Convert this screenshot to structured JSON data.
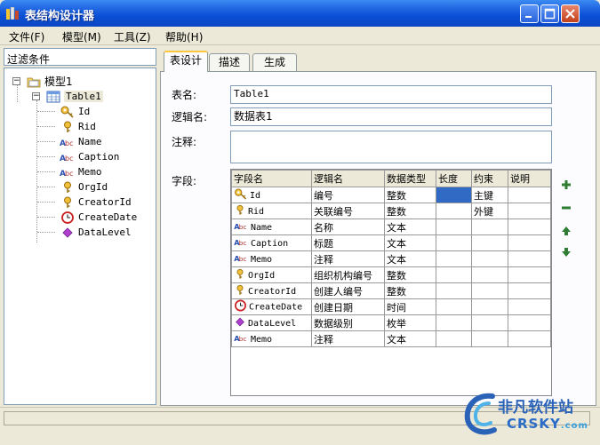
{
  "window": {
    "title": "表结构设计器"
  },
  "menu": [
    {
      "label": "文件(F)"
    },
    {
      "label": "模型(M)"
    },
    {
      "label": "工具(Z)"
    },
    {
      "label": "帮助(H)"
    }
  ],
  "filter": {
    "label": "过滤条件"
  },
  "tree": {
    "model": "模型1",
    "table": "Table1",
    "fields": [
      {
        "name": "Id",
        "icon": "key-icon"
      },
      {
        "name": "Rid",
        "icon": "foreign-key-icon"
      },
      {
        "name": "Name",
        "icon": "text-type-icon"
      },
      {
        "name": "Caption",
        "icon": "text-type-icon"
      },
      {
        "name": "Memo",
        "icon": "text-type-icon"
      },
      {
        "name": "OrgId",
        "icon": "foreign-key-icon"
      },
      {
        "name": "CreatorId",
        "icon": "foreign-key-icon"
      },
      {
        "name": "CreateDate",
        "icon": "clock-icon"
      },
      {
        "name": "DataLevel",
        "icon": "enum-diamond-icon"
      }
    ]
  },
  "tabs": [
    {
      "label": "表设计",
      "active": true
    },
    {
      "label": "描述",
      "active": false
    },
    {
      "label": "生成",
      "active": false
    }
  ],
  "form": {
    "table_name_label": "表名:",
    "table_name_value": "Table1",
    "logical_name_label": "逻辑名:",
    "logical_name_value": "数据表1",
    "comment_label": "注释:",
    "comment_value": "",
    "fields_label": "字段:"
  },
  "grid": {
    "headers": [
      "字段名",
      "逻辑名",
      "数据类型",
      "长度",
      "约束",
      "说明"
    ],
    "rows": [
      {
        "name": "Id",
        "icon": "key-icon",
        "logical": "编号",
        "type": "整数",
        "length": "",
        "constraint": "主键",
        "note": "",
        "selected_length": true
      },
      {
        "name": "Rid",
        "icon": "foreign-key-icon",
        "logical": "关联编号",
        "type": "整数",
        "length": "",
        "constraint": "外键",
        "note": ""
      },
      {
        "name": "Name",
        "icon": "text-type-icon",
        "logical": "名称",
        "type": "文本",
        "length": "",
        "constraint": "",
        "note": ""
      },
      {
        "name": "Caption",
        "icon": "text-type-icon",
        "logical": "标题",
        "type": "文本",
        "length": "",
        "constraint": "",
        "note": ""
      },
      {
        "name": "Memo",
        "icon": "text-type-icon",
        "logical": "注释",
        "type": "文本",
        "length": "",
        "constraint": "",
        "note": ""
      },
      {
        "name": "OrgId",
        "icon": "foreign-key-icon",
        "logical": "组织机构编号",
        "type": "整数",
        "length": "",
        "constraint": "",
        "note": ""
      },
      {
        "name": "CreatorId",
        "icon": "foreign-key-icon",
        "logical": "创建人编号",
        "type": "整数",
        "length": "",
        "constraint": "",
        "note": ""
      },
      {
        "name": "CreateDate",
        "icon": "clock-icon",
        "logical": "创建日期",
        "type": "时间",
        "length": "",
        "constraint": "",
        "note": ""
      },
      {
        "name": "DataLevel",
        "icon": "enum-diamond-icon",
        "logical": "数据级别",
        "type": "枚举",
        "length": "",
        "constraint": "",
        "note": ""
      },
      {
        "name": "Memo",
        "icon": "text-type-icon",
        "logical": "注释",
        "type": "文本",
        "length": "",
        "constraint": "",
        "note": ""
      }
    ]
  },
  "side_buttons": [
    {
      "icon": "add-icon",
      "color": "#2e7d32"
    },
    {
      "icon": "remove-icon",
      "color": "#2e7d32"
    },
    {
      "icon": "move-up-icon",
      "color": "#2e7d32"
    },
    {
      "icon": "move-down-icon",
      "color": "#2e7d32"
    }
  ],
  "watermark": {
    "name": "非凡软件站",
    "domain": "CRSKY",
    "tld": ".com"
  },
  "colors": {
    "titlebar": "#0a4fd6",
    "selection": "#316ac5",
    "tab_highlight": "#ffc73c"
  }
}
